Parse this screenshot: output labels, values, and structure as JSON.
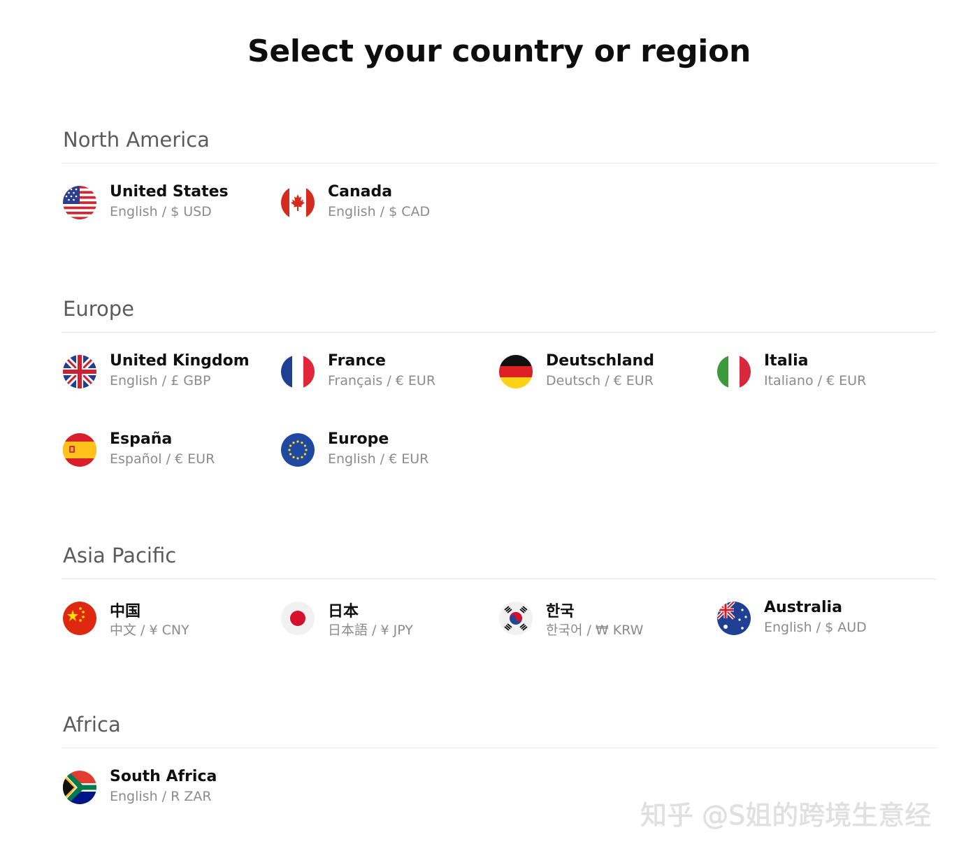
{
  "page": {
    "title": "Select your country or region"
  },
  "regions": [
    {
      "name": "North America",
      "countries": [
        {
          "name": "United States",
          "meta": "English / $ USD",
          "flag": "us-flag-icon"
        },
        {
          "name": "Canada",
          "meta": "English / $ CAD",
          "flag": "ca-flag-icon"
        }
      ]
    },
    {
      "name": "Europe",
      "countries": [
        {
          "name": "United Kingdom",
          "meta": "English / £ GBP",
          "flag": "gb-flag-icon"
        },
        {
          "name": "France",
          "meta": "Français / € EUR",
          "flag": "fr-flag-icon"
        },
        {
          "name": "Deutschland",
          "meta": "Deutsch / € EUR",
          "flag": "de-flag-icon"
        },
        {
          "name": "Italia",
          "meta": "Italiano / € EUR",
          "flag": "it-flag-icon"
        },
        {
          "name": "España",
          "meta": "Español / € EUR",
          "flag": "es-flag-icon"
        },
        {
          "name": "Europe",
          "meta": "English / € EUR",
          "flag": "eu-flag-icon"
        }
      ]
    },
    {
      "name": "Asia Pacific",
      "countries": [
        {
          "name": "中国",
          "meta": "中文 / ¥ CNY",
          "flag": "cn-flag-icon"
        },
        {
          "name": "日本",
          "meta": "日本語 / ¥ JPY",
          "flag": "jp-flag-icon"
        },
        {
          "name": "한국",
          "meta": "한국어 / ₩ KRW",
          "flag": "kr-flag-icon"
        },
        {
          "name": "Australia",
          "meta": "English / $ AUD",
          "flag": "au-flag-icon"
        }
      ]
    },
    {
      "name": "Africa",
      "countries": [
        {
          "name": "South Africa",
          "meta": "English / R ZAR",
          "flag": "za-flag-icon"
        }
      ]
    }
  ],
  "watermark": "知乎 @S姐的跨境生意经"
}
